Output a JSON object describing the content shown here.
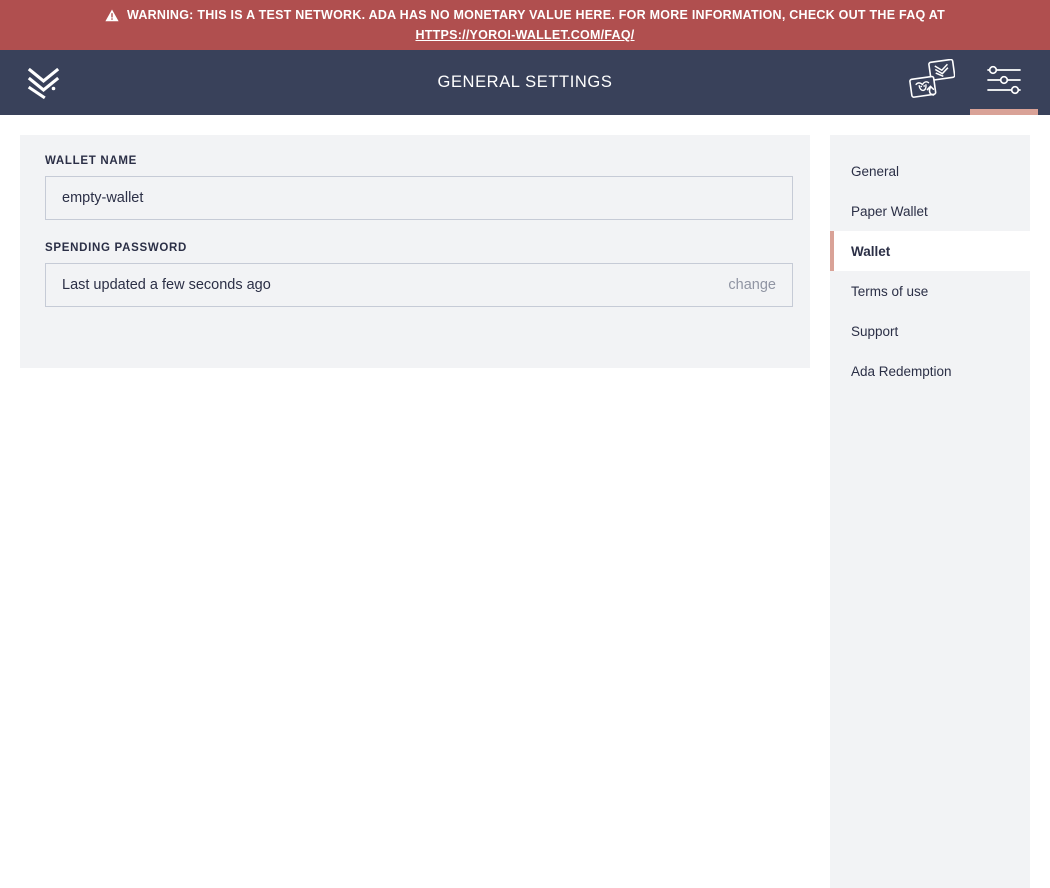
{
  "warning": {
    "icon": "warning-triangle-icon",
    "text": "WARNING: THIS IS A TEST NETWORK. ADA HAS NO MONETARY VALUE HERE. FOR MORE INFORMATION, CHECK OUT THE FAQ AT",
    "link_text": "HTTPS://YOROI-WALLET.COM/FAQ/",
    "background_color": "#b04f4f"
  },
  "topbar": {
    "logo": "yoroi-chevron-logo-icon",
    "title": "GENERAL SETTINGS",
    "background_color": "#39415a",
    "actions": [
      {
        "name": "switch-wallet-icon",
        "label": "Switch wallet",
        "active": false
      },
      {
        "name": "settings-sliders-icon",
        "label": "Settings",
        "active": true
      }
    ],
    "active_indicator_color": "#d9a297"
  },
  "main": {
    "wallet_name": {
      "label": "WALLET NAME",
      "value": "empty-wallet",
      "placeholder": "Wallet name"
    },
    "spending_password": {
      "label": "SPENDING PASSWORD",
      "value": "Last updated a few seconds ago",
      "action_label": "change"
    }
  },
  "settings_menu": {
    "items": [
      {
        "label": "General",
        "active": false
      },
      {
        "label": "Paper Wallet",
        "active": false
      },
      {
        "label": "Wallet",
        "active": true
      },
      {
        "label": "Terms of use",
        "active": false
      },
      {
        "label": "Support",
        "active": false
      },
      {
        "label": "Ada Redemption",
        "active": false
      }
    ],
    "accent_color": "#d9a297"
  }
}
